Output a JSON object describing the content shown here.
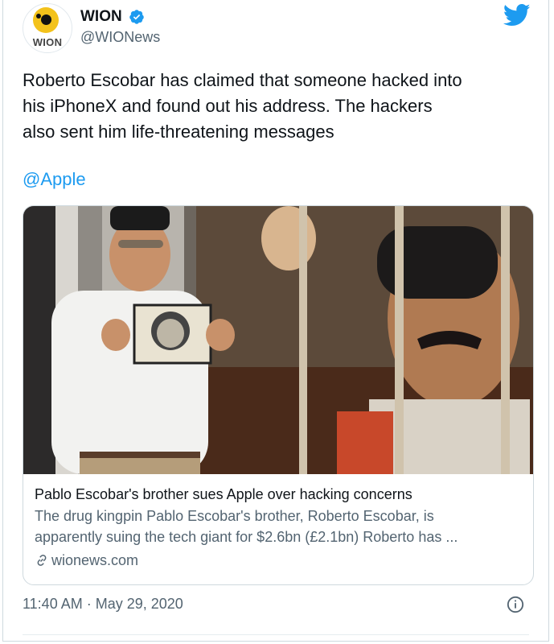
{
  "account": {
    "name": "WION",
    "handle": "@WIONews",
    "avatar_text": "WION",
    "verified": true
  },
  "tweet": {
    "text_line1": "Roberto Escobar has claimed that someone hacked into",
    "text_line2": "his iPhoneX and found out his address. The hackers",
    "text_line3": "also sent him life-threatening messages",
    "mention": "@Apple"
  },
  "card": {
    "title": "Pablo Escobar's brother sues Apple over hacking concerns",
    "description_line1": "The drug kingpin Pablo Escobar's brother, Roberto Escobar, is",
    "description_line2": "apparently suing the tech giant for $2.6bn (£2.1bn) Roberto has ...",
    "domain": "wionews.com"
  },
  "meta": {
    "timestamp": "11:40 AM · May 29, 2020"
  },
  "colors": {
    "accent": "#1d9bf0",
    "text": "#0f1419",
    "secondary": "#536471",
    "border": "#cfd9de"
  },
  "icons": [
    "verified-badge-icon",
    "twitter-bird-icon",
    "link-icon",
    "info-icon"
  ]
}
